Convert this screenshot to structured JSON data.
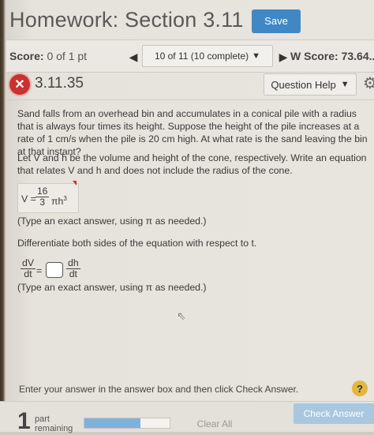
{
  "header": {
    "title": "Homework: Section 3.11",
    "save_label": "Save"
  },
  "scorebar": {
    "score_label": "Score:",
    "score_value": "0 of 1 pt",
    "nav_position": "10 of 11 (10 complete)",
    "hw_score_label": "W Score:",
    "hw_score_value": "73.64.."
  },
  "question": {
    "number": "3.11.35",
    "help_label": "Question Help"
  },
  "problem": {
    "text": "Sand falls from an overhead bin and accumulates in a conical pile with a radius that is always four times its height. Suppose the height of the pile increases at a rate of 1 cm/s when the pile is 20 cm high. At what rate is the sand leaving the bin at that instant?",
    "part1": "Let V and h be the volume and height of the cone, respectively. Write an equation that relates V and h and does not include the radius of the cone.",
    "eq1_lhs": "V =",
    "eq1_num": "16",
    "eq1_den": "3",
    "eq1_pi": "πh",
    "eq1_exp": "3",
    "hint1": "(Type an exact answer, using π as needed.)",
    "part2": "Differentiate both sides of the equation with respect to t.",
    "eq2_num1": "dV",
    "eq2_den1": "dt",
    "eq2_equals": "=",
    "eq2_num2": "dh",
    "eq2_den2": "dt",
    "hint2": "(Type an exact answer, using π as needed.)"
  },
  "footer": {
    "instruction": "Enter your answer in the answer box and then click Check Answer.",
    "help_symbol": "?",
    "parts_count": "1",
    "parts_label": "part remaining",
    "progress": 0.66,
    "clear_label": "Clear All",
    "check_label": "Check Answer"
  }
}
